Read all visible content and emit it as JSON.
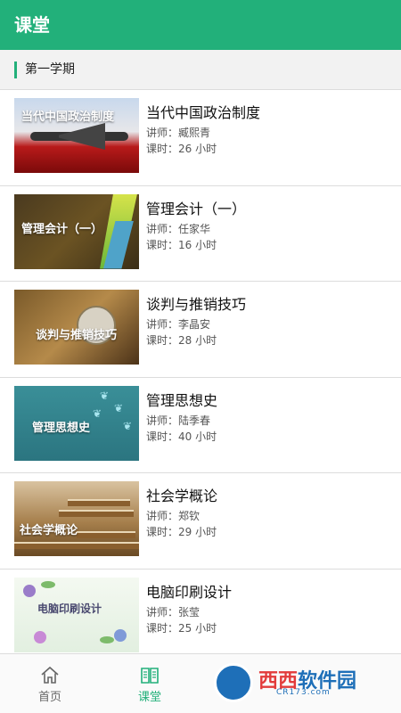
{
  "header": {
    "title": "课堂"
  },
  "semester": {
    "label": "第一学期"
  },
  "courses": [
    {
      "title": "当代中国政治制度",
      "teacher": "讲师：臧熙青",
      "hours": "课时：26 小时",
      "thumb_caption": "当代中国政治制度"
    },
    {
      "title": "管理会计（一）",
      "teacher": "讲师：任家华",
      "hours": "课时：16 小时",
      "thumb_caption": "管理会计（一）"
    },
    {
      "title": "谈判与推销技巧",
      "teacher": "讲师：李晶安",
      "hours": "课时：28 小时",
      "thumb_caption": "谈判与推销技巧"
    },
    {
      "title": "管理思想史",
      "teacher": "讲师：陆季春",
      "hours": "课时：40 小时",
      "thumb_caption": "管理思想史"
    },
    {
      "title": "社会学概论",
      "teacher": "讲师：郑钦",
      "hours": "课时：29 小时",
      "thumb_caption": "社会学概论"
    },
    {
      "title": "电脑印刷设计",
      "teacher": "讲师：张莹",
      "hours": "课时：25 小时",
      "thumb_caption": "电脑印刷设计"
    }
  ],
  "tabs": [
    {
      "label": "首页",
      "icon": "home-icon",
      "active": false
    },
    {
      "label": "课堂",
      "icon": "book-icon",
      "active": true
    }
  ],
  "watermark": {
    "brand_a": "西西",
    "brand_b": "软件园",
    "url": "CR173.com"
  },
  "colors": {
    "accent": "#22b07a",
    "header_bg": "#22b07a",
    "watermark_blue": "#1e6fb8"
  }
}
